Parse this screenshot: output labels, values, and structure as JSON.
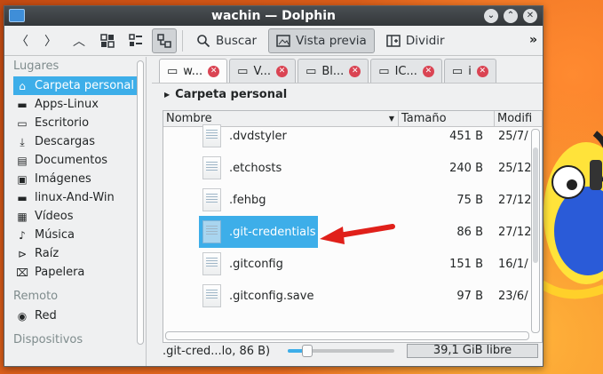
{
  "window": {
    "title": "wachin — Dolphin"
  },
  "toolbar": {
    "search_label": "Buscar",
    "preview_label": "Vista previa",
    "split_label": "Dividir"
  },
  "sidebar": {
    "places_heading": "Lugares",
    "places": [
      {
        "label": "Carpeta personal",
        "icon": "home-icon",
        "selected": true
      },
      {
        "label": "Apps-Linux",
        "icon": "folder-icon"
      },
      {
        "label": "Escritorio",
        "icon": "desktop-icon"
      },
      {
        "label": "Descargas",
        "icon": "download-icon"
      },
      {
        "label": "Documentos",
        "icon": "documents-icon"
      },
      {
        "label": "Imágenes",
        "icon": "pictures-icon"
      },
      {
        "label": "linux-And-Win",
        "icon": "folder-icon"
      },
      {
        "label": "Vídeos",
        "icon": "videos-icon"
      },
      {
        "label": "Música",
        "icon": "music-icon"
      },
      {
        "label": "Raíz",
        "icon": "root-icon"
      },
      {
        "label": "Papelera",
        "icon": "trash-icon"
      }
    ],
    "remote_heading": "Remoto",
    "remote": [
      {
        "label": "Red",
        "icon": "network-icon"
      }
    ],
    "devices_heading": "Dispositivos"
  },
  "tabs": [
    {
      "label": "w...",
      "active": true
    },
    {
      "label": "V..."
    },
    {
      "label": "Bl..."
    },
    {
      "label": "IC..."
    },
    {
      "label": "i"
    }
  ],
  "location": {
    "label": "Carpeta personal"
  },
  "columns": {
    "name": "Nombre",
    "size": "Tamaño",
    "date": "Modifi"
  },
  "files": [
    {
      "name": ".dvdstyler",
      "size": "451 B",
      "date": "25/7/"
    },
    {
      "name": ".etchosts",
      "size": "240 B",
      "date": "25/12"
    },
    {
      "name": ".fehbg",
      "size": "75 B",
      "date": "27/12"
    },
    {
      "name": ".git-credentials",
      "size": "86 B",
      "date": "27/12",
      "selected": true
    },
    {
      "name": ".gitconfig",
      "size": "151 B",
      "date": "16/1/"
    },
    {
      "name": ".gitconfig.save",
      "size": "97 B",
      "date": "23/6/"
    }
  ],
  "status": {
    "text": ".git-cred...lo, 86 B)",
    "zoom_fraction": 0.18,
    "free_space": "39,1 GiB libre"
  },
  "colors": {
    "accent": "#3daee9",
    "arrow": "#e0201a"
  }
}
